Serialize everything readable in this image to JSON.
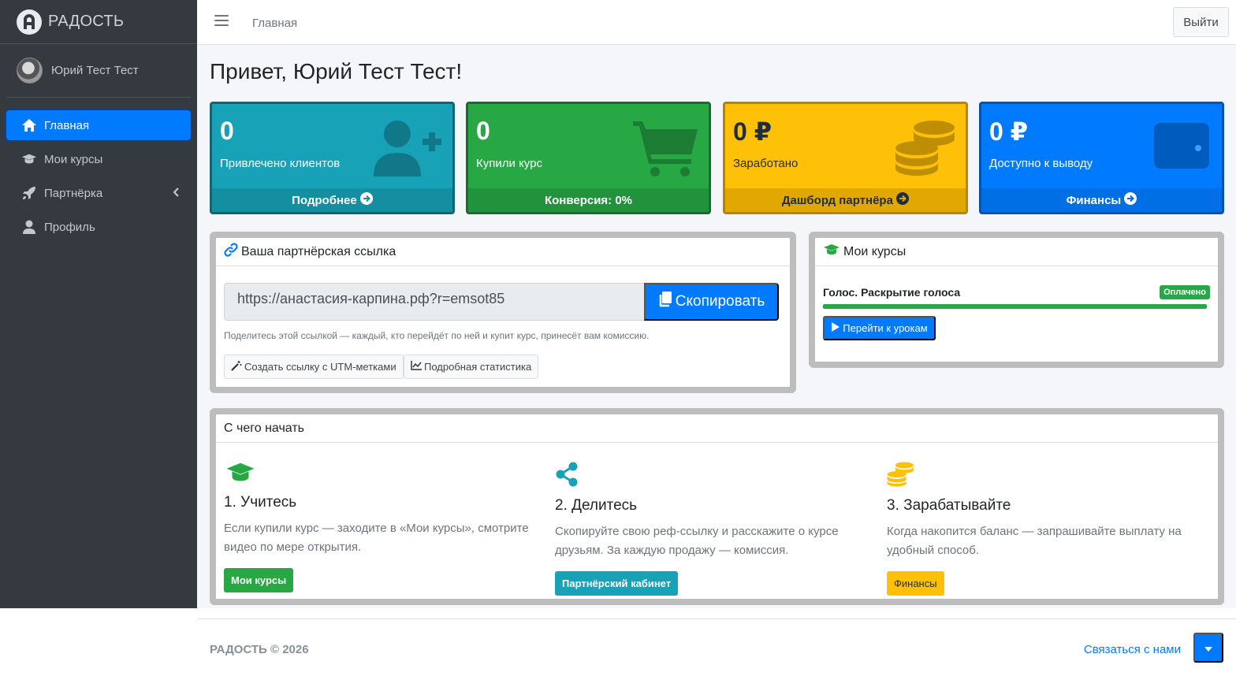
{
  "brand": {
    "name": "РАДОСТЬ"
  },
  "user": {
    "name": "Юрий Тест Тест"
  },
  "nav": [
    {
      "label": "Главная",
      "icon": "home-icon",
      "active": true
    },
    {
      "label": "Мои курсы",
      "icon": "graduation-cap-icon"
    },
    {
      "label": "Партнёрка",
      "icon": "rocket-icon",
      "has_submenu": true
    },
    {
      "label": "Профиль",
      "icon": "user-icon"
    }
  ],
  "topbar": {
    "breadcrumb": "Главная",
    "logout": "Выйти"
  },
  "greeting": "Привет, Юрий Тест Тест!",
  "stats": [
    {
      "value": "0",
      "label": "Привлечено клиентов",
      "footer": "Подробнее",
      "color": "#17a2b8",
      "footer_color": "#148ea1",
      "border": "#0f6674",
      "icon": "user-plus-icon"
    },
    {
      "value": "0",
      "label": "Купили курс",
      "footer": "Конверсия: 0%",
      "color": "#28a745",
      "footer_color": "#23923d",
      "border": "#1a6b2d",
      "icon": "cart-icon"
    },
    {
      "value": "0 ₽",
      "label": "Заработано",
      "footer": "Дашборд партнёра",
      "color": "#ffc107",
      "footer_color": "#e0a800",
      "border": "#b38600",
      "icon": "coins-icon",
      "dark_text": true
    },
    {
      "value": "0 ₽",
      "label": "Доступно к выводу",
      "footer": "Финансы",
      "color": "#007bff",
      "footer_color": "#006fe6",
      "border": "#0052b3",
      "icon": "wallet-icon"
    }
  ],
  "referral": {
    "title": "Ваша партнёрская ссылка",
    "url": "https://анастасия-карпина.рф?r=emsot85",
    "copy_label": "Скопировать",
    "hint": "Поделитесь этой ссылкой — каждый, кто перейдёт по ней и купит курс, принесёт вам комиссию.",
    "utm_label": "Создать ссылку с UTM-метками",
    "stats_label": "Подробная статистика"
  },
  "my_courses": {
    "title": "Мои курсы",
    "course_name": "Голос. Раскрытие голоса",
    "status": "Оплачено",
    "progress": 1.0,
    "go_label": "Перейти к урокам"
  },
  "start": {
    "title": "С чего начать",
    "steps": [
      {
        "title": "1. Учитесь",
        "text": "Если купили курс — заходите в «Мои курсы», смотрите видео по мере открытия.",
        "button": "Мои курсы",
        "color": "#28a745",
        "icon": "graduation-cap-icon"
      },
      {
        "title": "2. Делитесь",
        "text": "Скопируйте свою реф-ссылку и расскажите о курсе друзьям. За каждую продажу — комиссия.",
        "button": "Партнёрский кабинет",
        "color": "#17a2b8",
        "icon": "share-icon"
      },
      {
        "title": "3. Зарабатывайте",
        "text": "Когда накопится баланс — запрашивайте выплату на удобный способ.",
        "button": "Финансы",
        "color": "#ffc107",
        "icon": "coins-icon"
      }
    ]
  },
  "footer": {
    "copyright": "РАДОСТЬ © 2026",
    "contact": "Связаться с нами"
  }
}
